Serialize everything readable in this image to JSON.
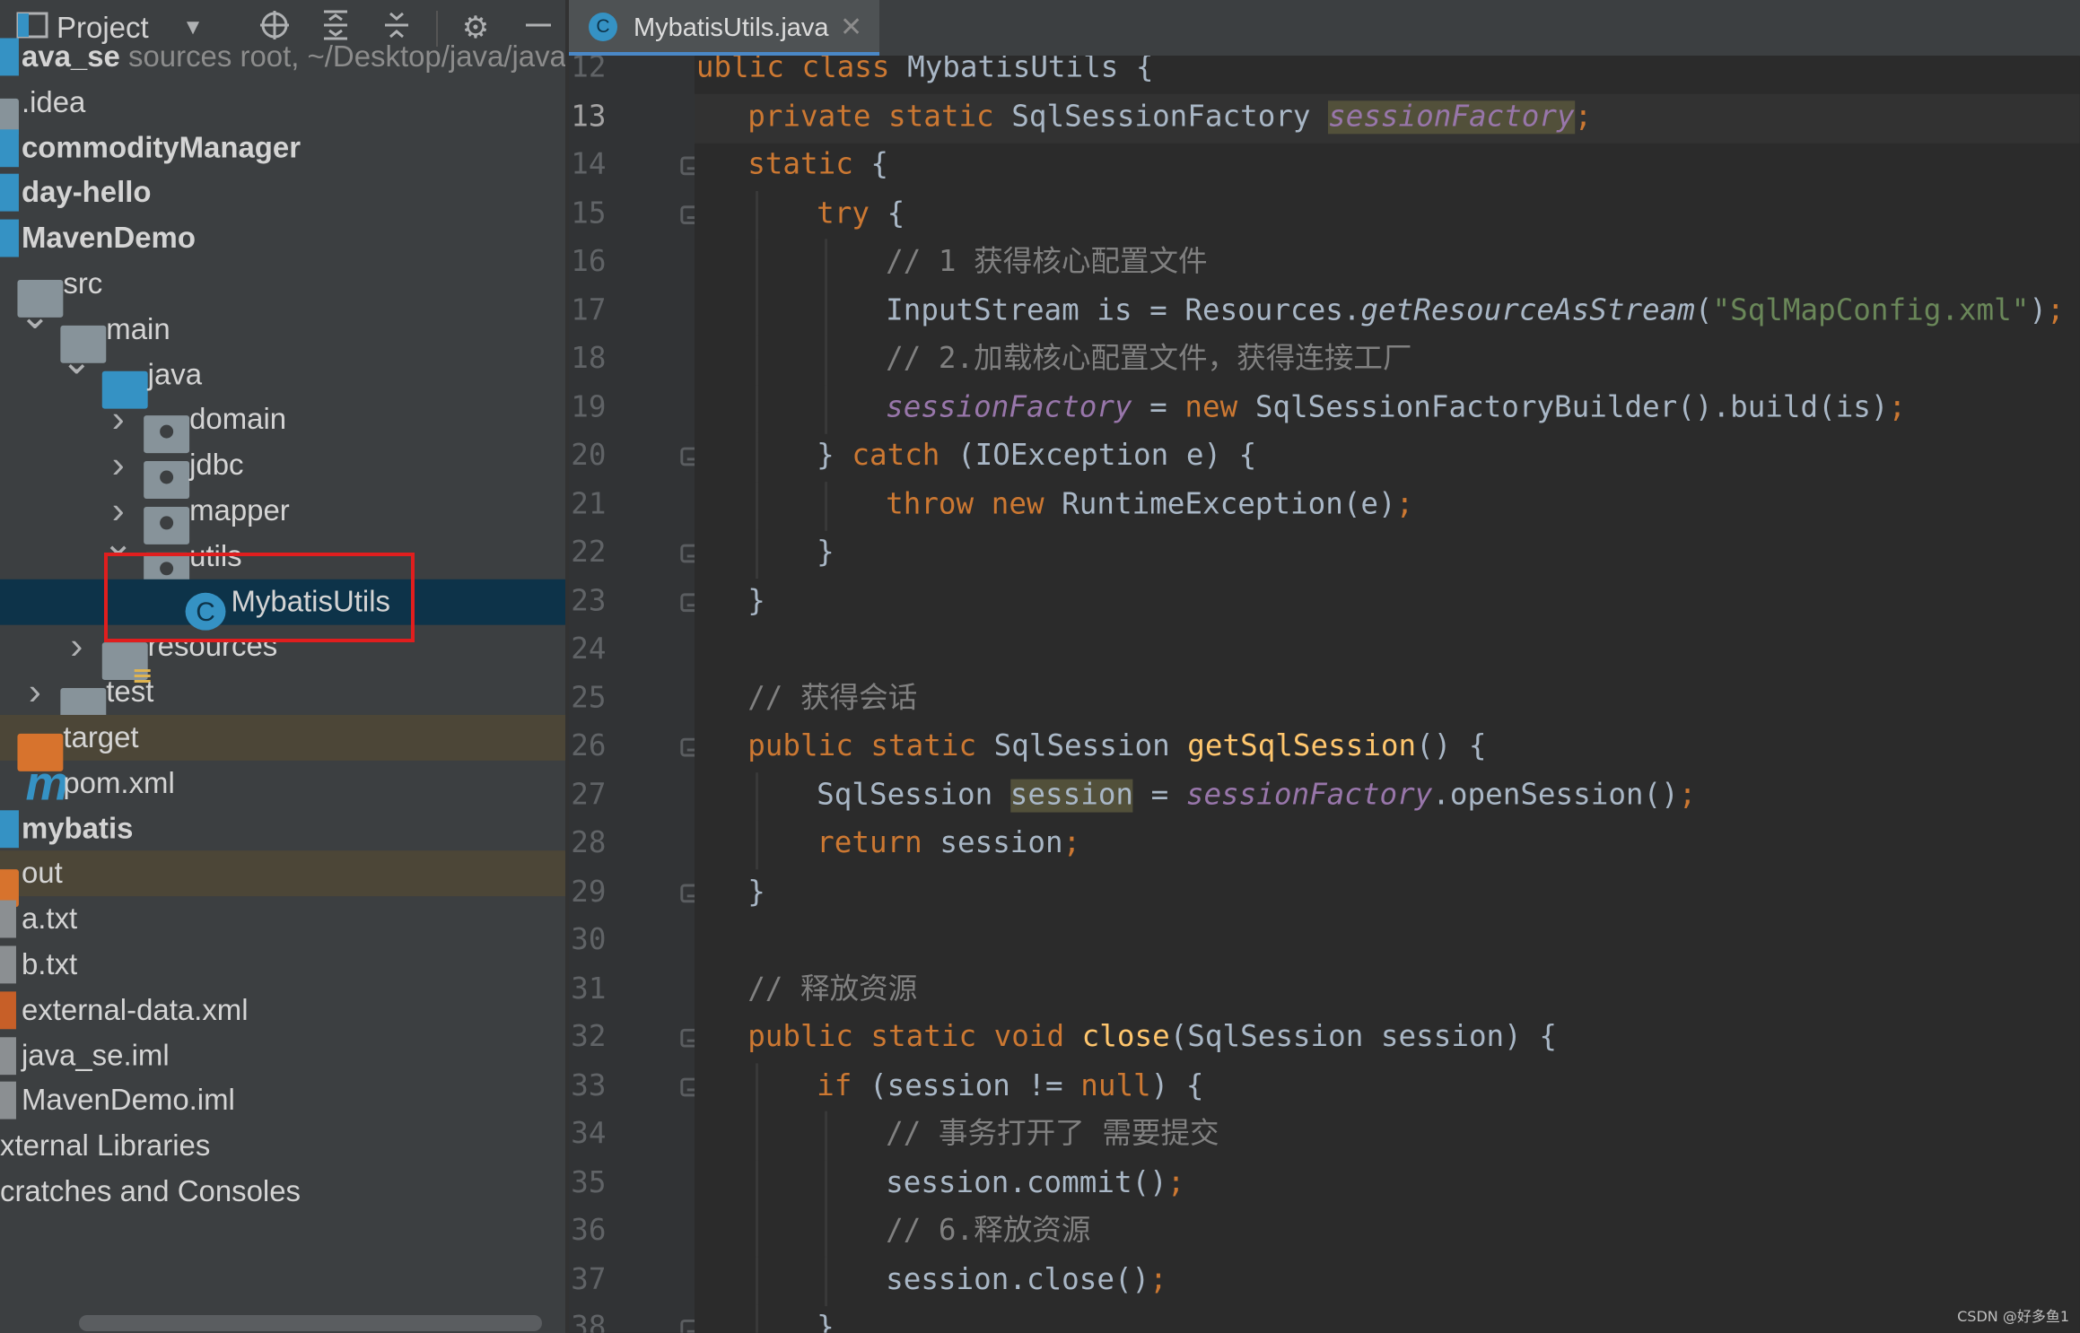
{
  "project_panel": {
    "title": "Project",
    "tree": [
      {
        "label": "ava_se",
        "hint": "sources root,  ~/Desktop/java/java_s",
        "bold": true,
        "icon": "module-folder-icon",
        "depth": 0,
        "indent": 0
      },
      {
        "label": ".idea",
        "icon": "folder-icon",
        "depth": 0
      },
      {
        "label": "commodityManager",
        "bold": true,
        "icon": "module-folder-icon",
        "depth": 0
      },
      {
        "label": "day-hello",
        "bold": true,
        "icon": "module-folder-icon",
        "depth": 0
      },
      {
        "label": "MavenDemo",
        "bold": true,
        "icon": "module-folder-icon",
        "depth": 0
      },
      {
        "label": "src",
        "icon": "folder-icon",
        "depth": 1
      },
      {
        "label": "main",
        "icon": "folder-icon",
        "depth": 2,
        "chevron": "open"
      },
      {
        "label": "java",
        "icon": "source-folder-icon",
        "depth": 3,
        "chevron": "open"
      },
      {
        "label": "domain",
        "icon": "package-icon",
        "depth": 4,
        "chevron": "closed"
      },
      {
        "label": "jdbc",
        "icon": "package-icon",
        "depth": 4,
        "chevron": "closed"
      },
      {
        "label": "mapper",
        "icon": "package-icon",
        "depth": 4,
        "chevron": "closed"
      },
      {
        "label": "utils",
        "icon": "package-icon",
        "depth": 4,
        "chevron": "open"
      },
      {
        "label": "MybatisUtils",
        "icon": "java-class-icon",
        "depth": 5,
        "selected": true
      },
      {
        "label": "resources",
        "icon": "resources-folder-icon",
        "depth": 3,
        "chevron": "closed"
      },
      {
        "label": "test",
        "icon": "folder-icon",
        "depth": 2,
        "chevron": "closed"
      },
      {
        "label": "target",
        "icon": "excluded-folder-icon",
        "depth": 1,
        "excluded": true
      },
      {
        "label": "pom.xml",
        "icon": "maven-icon",
        "depth": 1
      },
      {
        "label": "mybatis",
        "bold": true,
        "icon": "module-folder-icon",
        "depth": 0
      },
      {
        "label": "out",
        "icon": "excluded-folder-icon",
        "depth": 0,
        "excluded": true
      },
      {
        "label": "a.txt",
        "icon": "text-file-icon",
        "depth": 0
      },
      {
        "label": "b.txt",
        "icon": "text-file-icon",
        "depth": 0
      },
      {
        "label": "external-data.xml",
        "icon": "xml-file-icon",
        "depth": 0
      },
      {
        "label": "java_se.iml",
        "icon": "iml-file-icon",
        "depth": 0
      },
      {
        "label": "MavenDemo.iml",
        "icon": "iml-file-icon",
        "depth": 0
      },
      {
        "label": "xternal Libraries",
        "icon": "none",
        "depth": -1
      },
      {
        "label": "cratches and Consoles",
        "icon": "none",
        "depth": -1
      }
    ]
  },
  "editor": {
    "tab": {
      "label": "MybatisUtils.java",
      "icon": "java-class-icon",
      "icon_letter": "C",
      "close": "✕"
    },
    "current_line": 13,
    "lines": [
      {
        "n": 12,
        "indent": 0,
        "tokens": [
          [
            "k",
            "public "
          ],
          [
            "k",
            "class "
          ],
          [
            "p",
            "MybatisUtils {"
          ]
        ]
      },
      {
        "n": 13,
        "indent": 1,
        "tokens": [
          [
            "k",
            "private "
          ],
          [
            "k",
            "static "
          ],
          [
            "p",
            "SqlSessionFactory "
          ],
          [
            "fu",
            "sessionFactory"
          ],
          [
            "k",
            ";"
          ]
        ]
      },
      {
        "n": 14,
        "indent": 1,
        "fold": true,
        "tokens": [
          [
            "k",
            "static "
          ],
          [
            "p",
            "{"
          ]
        ]
      },
      {
        "n": 15,
        "indent": 2,
        "fold": true,
        "tokens": [
          [
            "k",
            "try "
          ],
          [
            "p",
            "{"
          ]
        ]
      },
      {
        "n": 16,
        "indent": 3,
        "tokens": [
          [
            "c",
            "// 1 获得核心配置文件"
          ]
        ]
      },
      {
        "n": 17,
        "indent": 3,
        "tokens": [
          [
            "p",
            "InputStream is = Resources."
          ],
          [
            "it",
            "getResourceAsStream"
          ],
          [
            "p",
            "("
          ],
          [
            "s",
            "\"SqlMapConfig.xml\""
          ],
          [
            "p",
            ")"
          ],
          [
            "k",
            ";"
          ]
        ]
      },
      {
        "n": 18,
        "indent": 3,
        "tokens": [
          [
            "c",
            "// 2.加载核心配置文件，获得连接工厂"
          ]
        ]
      },
      {
        "n": 19,
        "indent": 3,
        "tokens": [
          [
            "f",
            "sessionFactory"
          ],
          [
            "p",
            " = "
          ],
          [
            "k",
            "new "
          ],
          [
            "p",
            "SqlSessionFactoryBuilder().build(is)"
          ],
          [
            "k",
            ";"
          ]
        ]
      },
      {
        "n": 20,
        "indent": 2,
        "fold": true,
        "tokens": [
          [
            "p",
            "} "
          ],
          [
            "k",
            "catch "
          ],
          [
            "p",
            "(IOException e) {"
          ]
        ]
      },
      {
        "n": 21,
        "indent": 3,
        "tokens": [
          [
            "k",
            "throw "
          ],
          [
            "k",
            "new "
          ],
          [
            "p",
            "RuntimeException(e)"
          ],
          [
            "k",
            ";"
          ]
        ]
      },
      {
        "n": 22,
        "indent": 2,
        "fold": true,
        "tokens": [
          [
            "p",
            "}"
          ]
        ]
      },
      {
        "n": 23,
        "indent": 1,
        "fold": true,
        "tokens": [
          [
            "p",
            "}"
          ]
        ]
      },
      {
        "n": 24,
        "indent": 0,
        "tokens": []
      },
      {
        "n": 25,
        "indent": 1,
        "tokens": [
          [
            "c",
            "// 获得会话"
          ]
        ]
      },
      {
        "n": 26,
        "indent": 1,
        "fold": true,
        "tokens": [
          [
            "k",
            "public "
          ],
          [
            "k",
            "static "
          ],
          [
            "p",
            "SqlSession "
          ],
          [
            "m",
            "getSqlSession"
          ],
          [
            "p",
            "() {"
          ]
        ]
      },
      {
        "n": 27,
        "indent": 2,
        "tokens": [
          [
            "p",
            "SqlSession "
          ],
          [
            "pu",
            "session"
          ],
          [
            "p",
            " = "
          ],
          [
            "f",
            "sessionFactory"
          ],
          [
            "p",
            ".openSession()"
          ],
          [
            "k",
            ";"
          ]
        ]
      },
      {
        "n": 28,
        "indent": 2,
        "tokens": [
          [
            "k",
            "return "
          ],
          [
            "p",
            "session"
          ],
          [
            "k",
            ";"
          ]
        ]
      },
      {
        "n": 29,
        "indent": 1,
        "fold": true,
        "tokens": [
          [
            "p",
            "}"
          ]
        ]
      },
      {
        "n": 30,
        "indent": 0,
        "tokens": []
      },
      {
        "n": 31,
        "indent": 1,
        "tokens": [
          [
            "c",
            "// 释放资源"
          ]
        ]
      },
      {
        "n": 32,
        "indent": 1,
        "fold": true,
        "tokens": [
          [
            "k",
            "public "
          ],
          [
            "k",
            "static "
          ],
          [
            "k",
            "void "
          ],
          [
            "m",
            "close"
          ],
          [
            "p",
            "(SqlSession session) {"
          ]
        ]
      },
      {
        "n": 33,
        "indent": 2,
        "fold": true,
        "tokens": [
          [
            "k",
            "if "
          ],
          [
            "p",
            "(session != "
          ],
          [
            "k",
            "null"
          ],
          [
            "p",
            ") {"
          ]
        ]
      },
      {
        "n": 34,
        "indent": 3,
        "tokens": [
          [
            "c",
            "// 事务打开了 需要提交"
          ]
        ]
      },
      {
        "n": 35,
        "indent": 3,
        "tokens": [
          [
            "p",
            "session.commit()"
          ],
          [
            "k",
            ";"
          ]
        ]
      },
      {
        "n": 36,
        "indent": 3,
        "tokens": [
          [
            "c",
            "// 6.释放资源"
          ]
        ]
      },
      {
        "n": 37,
        "indent": 3,
        "tokens": [
          [
            "p",
            "session.close()"
          ],
          [
            "k",
            ";"
          ]
        ]
      },
      {
        "n": 38,
        "indent": 2,
        "fold": true,
        "tokens": [
          [
            "p",
            "}"
          ]
        ]
      }
    ]
  },
  "watermark": "CSDN @好多鱼1",
  "colors": {
    "keyword": "#cc7832",
    "field": "#9876aa",
    "method": "#ffc66d",
    "string": "#6a8759",
    "comment": "#808080",
    "text": "#a9b7c6",
    "highlight_box": "#e01e1e"
  }
}
